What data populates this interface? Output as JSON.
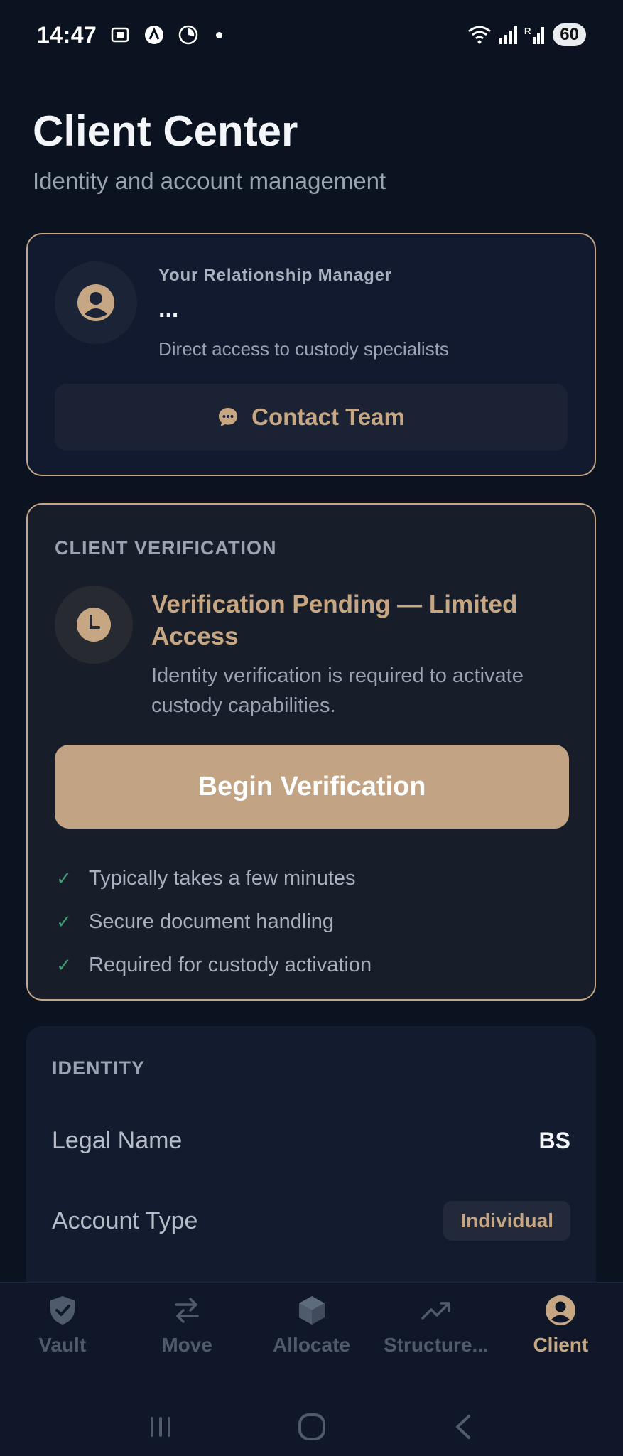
{
  "status": {
    "time": "14:47",
    "battery": "60"
  },
  "header": {
    "title": "Client Center",
    "subtitle": "Identity and account management"
  },
  "manager": {
    "label": "Your Relationship Manager",
    "name": "...",
    "description": "Direct access to custody specialists",
    "contact_label": "Contact Team"
  },
  "verification": {
    "section_label": "CLIENT VERIFICATION",
    "title": "Verification Pending — Limited Access",
    "description": "Identity verification is required to activate custody capabilities.",
    "button_label": "Begin Verification",
    "checks": [
      "Typically takes a few minutes",
      "Secure document handling",
      "Required for custody activation"
    ]
  },
  "identity": {
    "section_label": "IDENTITY",
    "rows": [
      {
        "key": "Legal Name",
        "value": "BS"
      },
      {
        "key": "Account Type",
        "value": "Individual"
      }
    ]
  },
  "nav": {
    "tabs": [
      {
        "label": "Vault",
        "icon": "shield-check-icon"
      },
      {
        "label": "Move",
        "icon": "swap-arrows-icon"
      },
      {
        "label": "Allocate",
        "icon": "cube-icon"
      },
      {
        "label": "Structure...",
        "icon": "trend-up-icon"
      },
      {
        "label": "Client",
        "icon": "user-circle-icon"
      }
    ],
    "active": "Client"
  },
  "colors": {
    "accent": "#c2a383",
    "background": "#0b1220",
    "success": "#3e9d72"
  }
}
